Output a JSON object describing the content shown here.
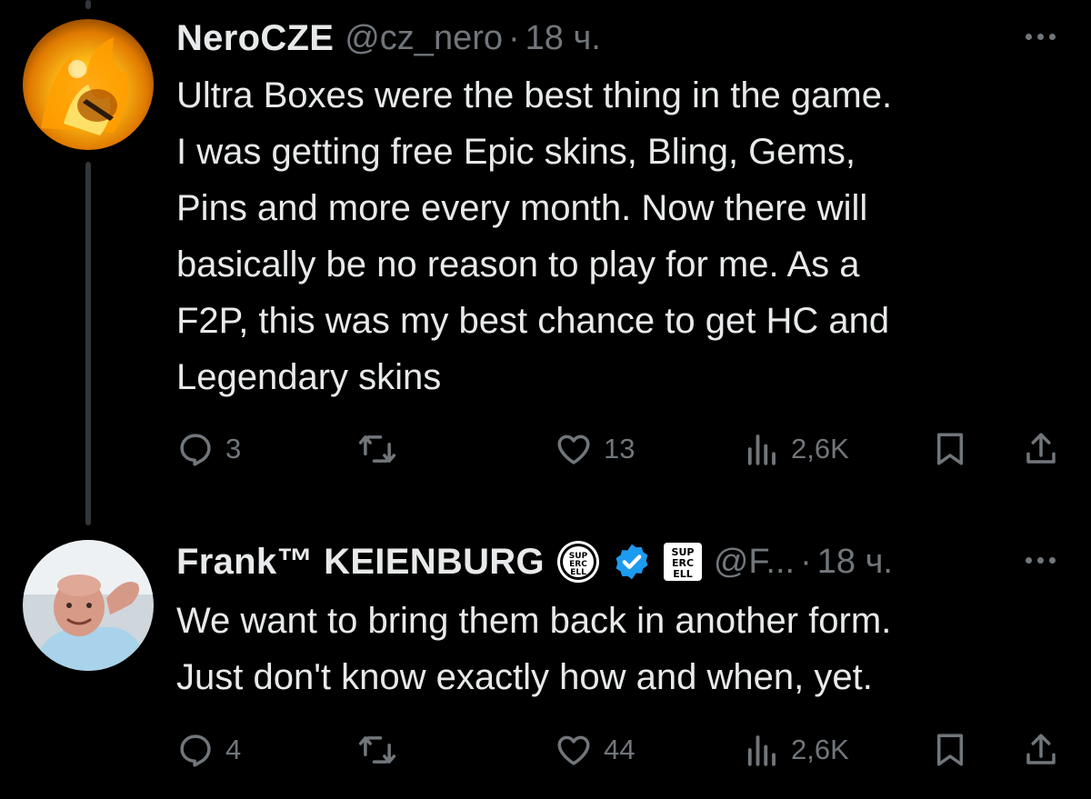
{
  "posts": [
    {
      "author": "NeroCZE",
      "handle": "@cz_nero",
      "separator": "·",
      "time": "18 ч.",
      "lines": [
        "Ultra Boxes were the best thing in the game.",
        "I was getting free Epic skins, Bling, Gems,",
        "Pins and more every month. Now there will",
        "basically be no reason to play for me. As a",
        "F2P, this was my best chance to get HC and",
        "Legendary skins"
      ],
      "replies": "3",
      "reposts": "",
      "likes": "13",
      "views": "2,6K"
    },
    {
      "author": "Frank™ KEIENBURG",
      "handle": "@F...",
      "separator": "·",
      "time": "18 ч.",
      "badge_text": "SUP ERC ELL",
      "lines": [
        "We want to bring them back in another form.",
        "Just don't know exactly how and when, yet."
      ],
      "replies": "4",
      "reposts": "",
      "likes": "44",
      "views": "2,6K"
    }
  ],
  "icons": {
    "reply": "reply-icon",
    "repost": "repost-icon",
    "like": "heart-icon",
    "views": "views-icon",
    "bookmark": "bookmark-icon",
    "share": "share-icon",
    "more": "more-icon",
    "verified": "verified-badge-icon",
    "affiliate": "supercell-badge-icon"
  },
  "colors": {
    "background": "#000000",
    "text": "#e7e9ea",
    "muted": "#71767b",
    "verified": "#1d9bf0"
  }
}
